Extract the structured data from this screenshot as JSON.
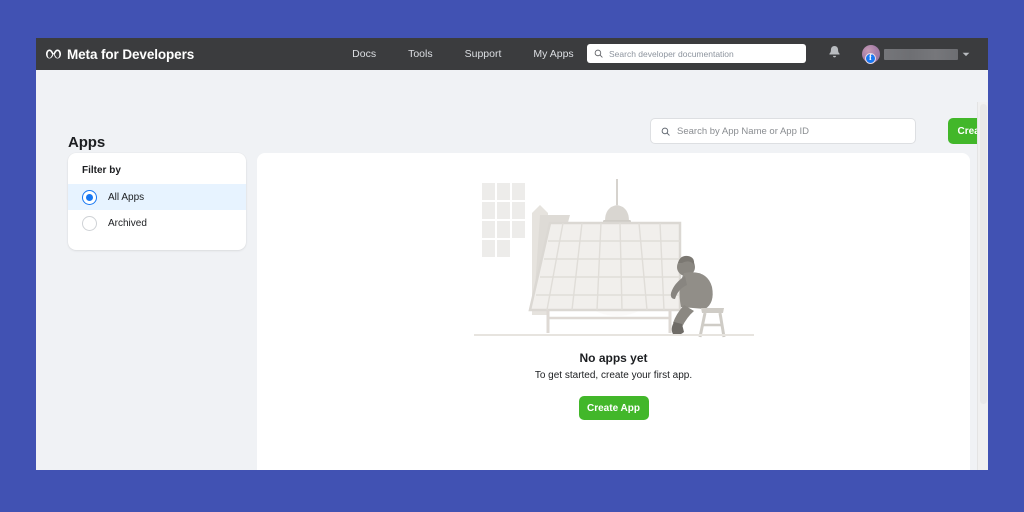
{
  "window": {
    "background_color": "#4152b3",
    "page_background": "#f0f2f5"
  },
  "top_nav": {
    "brand": "Meta for Developers",
    "brand_logo_icon": "meta-infinity-logo",
    "links": [
      {
        "label": "Docs"
      },
      {
        "label": "Tools"
      },
      {
        "label": "Support"
      },
      {
        "label": "My Apps"
      }
    ],
    "search": {
      "icon": "search-icon",
      "placeholder": "Search developer documentation",
      "value": ""
    },
    "notifications_icon": "bell-icon",
    "account": {
      "avatar_icon": "user-avatar",
      "platform_badge_icon": "facebook-badge-icon",
      "badge_letter": "f",
      "name_redacted": "",
      "chevron_icon": "chevron-down-icon"
    },
    "background_color": "#3b3c3e"
  },
  "page": {
    "title": "Apps",
    "app_search": {
      "icon": "search-icon",
      "placeholder": "Search by App Name or App ID",
      "value": ""
    },
    "create_app_button": {
      "label": "Create App",
      "color": "#42b72a"
    }
  },
  "filter_card": {
    "title": "Filter by",
    "options": [
      {
        "label": "All Apps",
        "selected": true
      },
      {
        "label": "Archived",
        "selected": false
      }
    ],
    "selected_row_color": "#e7f3ff",
    "radio_color": "#1877f2"
  },
  "empty_state": {
    "illustration_icon": "person-at-drafting-table-illustration",
    "title": "No apps yet",
    "subtitle": "To get started, create your first app.",
    "create_app_button": {
      "label": "Create App",
      "color": "#42b72a"
    }
  },
  "scrollbar": {
    "name": "vertical-scrollbar"
  }
}
